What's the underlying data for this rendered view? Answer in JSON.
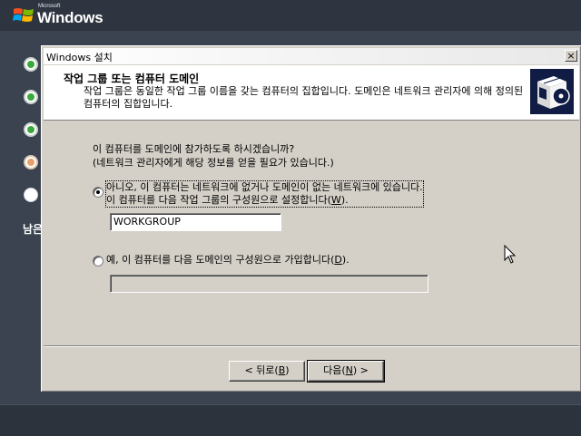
{
  "branding": {
    "company": "Microsoft",
    "product": "Windows",
    "flag_colors": [
      "#f25022",
      "#7fba00",
      "#00a4ef",
      "#ffb900"
    ]
  },
  "sidebar": {
    "steps": [
      {
        "state": "done"
      },
      {
        "state": "done"
      },
      {
        "state": "done"
      },
      {
        "state": "current"
      },
      {
        "state": "todo"
      }
    ],
    "remaining_label": "남은"
  },
  "dialog": {
    "title": "Windows 설치",
    "close_label": "×",
    "header": {
      "title": "작업 그룹 또는 컴퓨터 도메인",
      "description": "작업 그룹은 동일한 작업 그룹 이름을 갖는 컴퓨터의 집합입니다. 도메인은 네트워크 관리자에 의해 정의된 컴퓨터의 집합입니다.",
      "icon": "setup-box-icon"
    },
    "question_line1": "이 컴퓨터를 도메인에 참가하도록 하시겠습니까?",
    "question_line2": "(네트워크 관리자에게 해당 정보를 얻을 필요가 있습니다.)",
    "option_workgroup": {
      "line1": "아니오, 이 컴퓨터는 네트워크에 없거나 도메인이 없는 네트워크에 있습니다.",
      "line2_prefix": "이 컴퓨터를 다음 작업 그룹의 구성원으로 설정합니다(",
      "line2_key": "W",
      "line2_suffix": ").",
      "selected": true,
      "value": "WORKGROUP"
    },
    "option_domain": {
      "label_prefix": "예, 이 컴퓨터를 다음 도메인의 구성원으로 가입합니다(",
      "label_key": "D",
      "label_suffix": ").",
      "selected": false,
      "value": ""
    },
    "buttons": {
      "back_prefix": "< 뒤로(",
      "back_key": "B",
      "back_suffix": ")",
      "next_prefix": "다음(",
      "next_key": "N",
      "next_suffix": ") >"
    }
  },
  "colors": {
    "backdrop": "#3b4350",
    "dialog_face": "#d4d0c8",
    "step_done": "#3aa83a",
    "step_current": "#e8a06a"
  }
}
